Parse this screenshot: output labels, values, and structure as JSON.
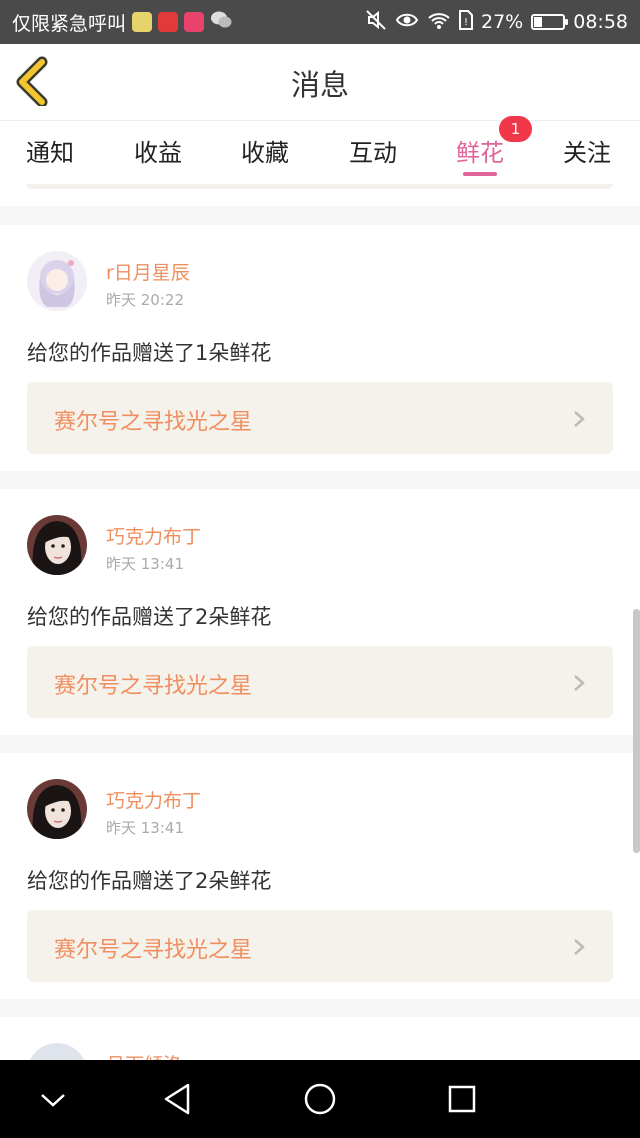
{
  "status_bar": {
    "carrier_text": "仅限紧急呼叫",
    "battery_percent": "27%",
    "battery_level": 0.27,
    "time": "08:58",
    "app_icons": [
      "app-icon-1",
      "toutiao-icon",
      "video-icon",
      "wechat-icon"
    ],
    "status_icons": [
      "mute-icon",
      "eye-icon",
      "wifi-icon",
      "sim-icon",
      "battery-icon"
    ]
  },
  "header": {
    "title": "消息",
    "back_icon": "chevron-left-icon"
  },
  "tabs": [
    {
      "label": "通知"
    },
    {
      "label": "收益"
    },
    {
      "label": "收藏"
    },
    {
      "label": "互动"
    },
    {
      "label": "鲜花",
      "active": true,
      "badge": "1"
    },
    {
      "label": "关注"
    }
  ],
  "messages": [
    {
      "username": "r日月星辰",
      "time": "昨天 20:22",
      "text": "给您的作品赠送了1朵鲜花",
      "work_title": "赛尔号之寻找光之星"
    },
    {
      "username": "巧克力布丁",
      "time": "昨天 13:41",
      "text": "给您的作品赠送了2朵鲜花",
      "work_title": "赛尔号之寻找光之星"
    },
    {
      "username": "巧克力布丁",
      "time": "昨天 13:41",
      "text": "给您的作品赠送了2朵鲜花",
      "work_title": "赛尔号之寻找光之星"
    }
  ],
  "partial_message": {
    "username": "月下倾洛"
  },
  "colors": {
    "accent_pink": "#e0649a",
    "name_orange": "#ef8f60",
    "badge_red": "#f0384a",
    "back_yellow": "#f2c531"
  },
  "nav": [
    "down-icon",
    "back-triangle-icon",
    "home-circle-icon",
    "recents-square-icon"
  ]
}
